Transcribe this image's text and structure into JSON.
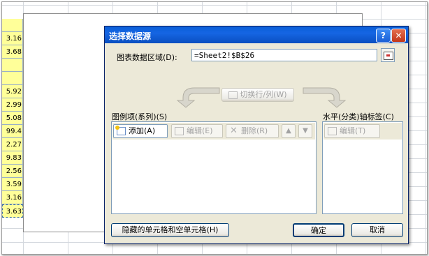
{
  "spreadsheet": {
    "cells": [
      "",
      "3.16",
      "3.68",
      "",
      "",
      "5.92",
      "2.99",
      "5.08",
      "99.4",
      "2.27",
      "9.83",
      "2.56",
      "3.59",
      "3.16",
      "3.63"
    ]
  },
  "dialog": {
    "title": "选择数据源",
    "help_glyph": "?",
    "close_glyph": "✕",
    "range_label": "图表数据区域",
    "range_hotkey": "(D):",
    "range_value": "=Sheet2!$B$26",
    "switch_label": "切换行/列",
    "switch_hotkey": "(W)",
    "legend": {
      "title": "图例项(系列)",
      "hotkey": "(S)",
      "add_label": "添加",
      "add_hotkey": "(A)",
      "edit_label": "编辑",
      "edit_hotkey": "(E)",
      "delete_label": "删除",
      "delete_hotkey": "(R)",
      "up_glyph": "▲",
      "down_glyph": "▼"
    },
    "axis": {
      "title": "水平(分类)轴标签",
      "hotkey": "(C)",
      "edit_label": "编辑",
      "edit_hotkey": "(T)"
    },
    "hidden_cells_label": "隐藏的单元格和空单元格",
    "hidden_cells_hotkey": "(H)",
    "ok_label": "确定",
    "cancel_label": "取消"
  }
}
